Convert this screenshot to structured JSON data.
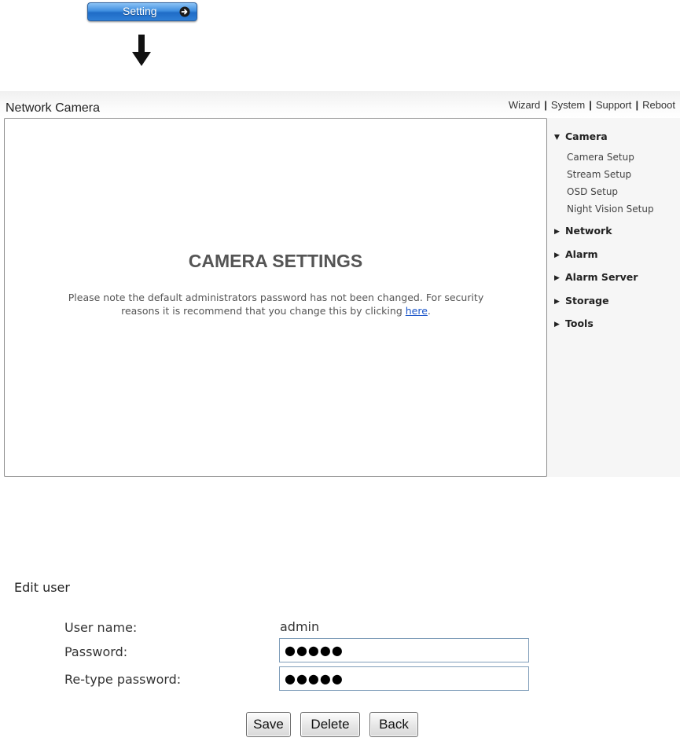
{
  "setting_button": {
    "label": "Setting",
    "icon": "arrow-right-circle-icon"
  },
  "header": {
    "title": "Network Camera",
    "nav": [
      {
        "label": "Wizard"
      },
      {
        "label": "System"
      },
      {
        "label": "Support"
      },
      {
        "label": "Reboot"
      }
    ],
    "separator": "|"
  },
  "main": {
    "heading": "CAMERA SETTINGS",
    "notice_line1": "Please note the default administrators password has not been changed. For security",
    "notice_line2_prefix": "reasons it is recommend that you change this by clicking ",
    "notice_link": "here",
    "notice_suffix": "."
  },
  "sidebar": {
    "sections": [
      {
        "label": "Camera",
        "expanded": true,
        "items": [
          "Camera Setup",
          "Stream Setup",
          "OSD Setup",
          "Night Vision Setup"
        ]
      },
      {
        "label": "Network",
        "expanded": false
      },
      {
        "label": "Alarm",
        "expanded": false
      },
      {
        "label": "Alarm Server",
        "expanded": false
      },
      {
        "label": "Storage",
        "expanded": false
      },
      {
        "label": "Tools",
        "expanded": false
      }
    ]
  },
  "edit_user": {
    "title": "Edit user",
    "username_label": "User name:",
    "username_value": "admin",
    "password_label": "Password:",
    "password_value": "●●●●●",
    "retype_label": "Re-type password:",
    "retype_value": "●●●●●",
    "buttons": {
      "save": "Save",
      "delete": "Delete",
      "back": "Back"
    }
  },
  "colors": {
    "link": "#1a55c9",
    "button_blue": "#2f7fd6"
  }
}
